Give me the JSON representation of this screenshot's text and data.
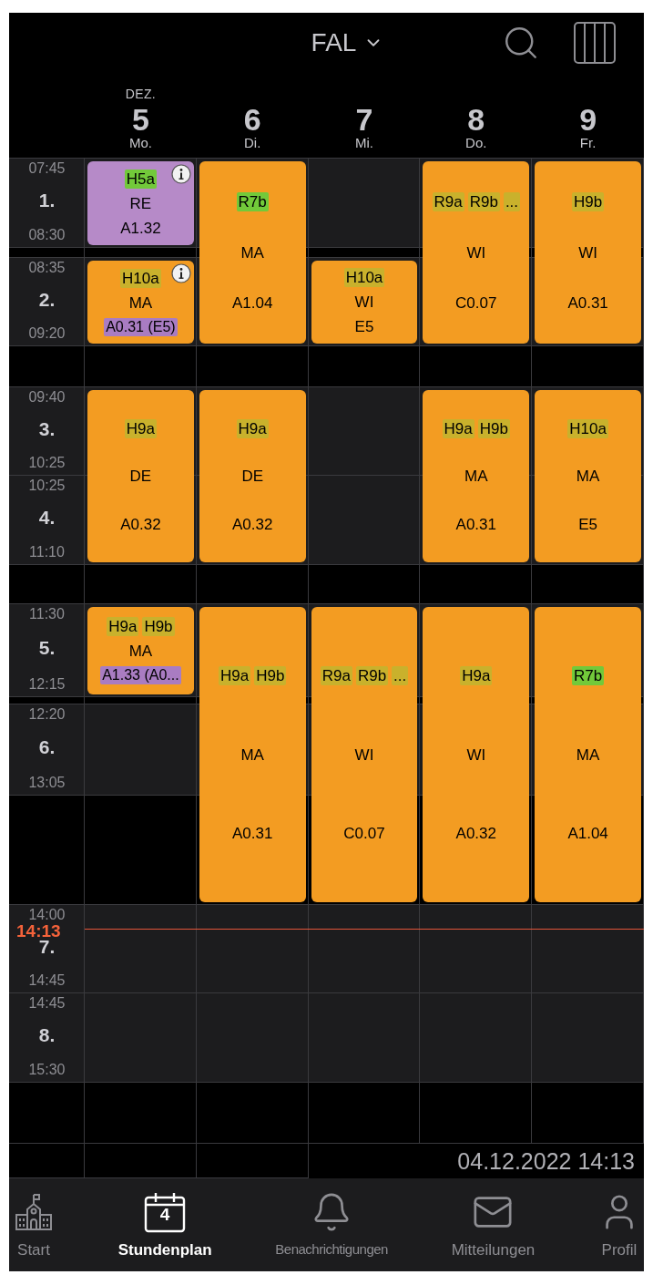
{
  "header": {
    "title": "FAL"
  },
  "month": "DEZ.",
  "days": [
    {
      "date": "5",
      "weekday": "Mo.",
      "lessons": [
        {
          "kind": "p1",
          "color": "#b68ac8",
          "info": true,
          "classes": [
            {
              "name": "H5a",
              "color": "#72c93a"
            }
          ],
          "subject": "RE",
          "room": "A1.32",
          "room_changed": false
        },
        {
          "kind": "p2",
          "color": "#f39c22",
          "info": true,
          "classes": [
            {
              "name": "H10a",
              "color": "#c9b12c"
            }
          ],
          "subject": "MA",
          "room": "A0.31 (E5)",
          "room_changed": true
        },
        {
          "kind": "p34",
          "color": "#f39c22",
          "info": false,
          "classes": [
            {
              "name": "H9a",
              "color": "#c9b12c"
            }
          ],
          "subject": "DE",
          "room": "A0.32",
          "room_changed": false
        },
        {
          "kind": "p5",
          "color": "#f39c22",
          "info": false,
          "classes": [
            {
              "name": "H9a",
              "color": "#c9b12c"
            },
            {
              "name": "H9b",
              "color": "#c9b12c"
            }
          ],
          "subject": "MA",
          "room": "A1.33 (A0...",
          "room_changed": true
        }
      ]
    },
    {
      "date": "6",
      "weekday": "Di.",
      "lessons": [
        {
          "kind": "p12",
          "color": "#f39c22",
          "info": false,
          "classes": [
            {
              "name": "R7b",
              "color": "#72c93a"
            }
          ],
          "subject": "MA",
          "room": "A1.04",
          "room_changed": false
        },
        {
          "kind": "p34",
          "color": "#f39c22",
          "info": false,
          "classes": [
            {
              "name": "H9a",
              "color": "#c9b12c"
            }
          ],
          "subject": "DE",
          "room": "A0.32",
          "room_changed": false
        },
        {
          "kind": "p56",
          "color": "#f39c22",
          "info": false,
          "classes": [
            {
              "name": "H9a",
              "color": "#c9b12c"
            },
            {
              "name": "H9b",
              "color": "#c9b12c"
            }
          ],
          "subject": "MA",
          "room": "A0.31",
          "room_changed": false
        }
      ]
    },
    {
      "date": "7",
      "weekday": "Mi.",
      "lessons": [
        {
          "kind": "p2",
          "color": "#f39c22",
          "info": false,
          "classes": [
            {
              "name": "H10a",
              "color": "#c9b12c"
            }
          ],
          "subject": "WI",
          "room": "E5",
          "room_changed": false
        },
        {
          "kind": "p56",
          "color": "#f39c22",
          "info": false,
          "classes": [
            {
              "name": "R9a",
              "color": "#c9b12c"
            },
            {
              "name": "R9b",
              "color": "#c9b12c"
            },
            {
              "name": "...",
              "color": "#c9b12c"
            }
          ],
          "subject": "WI",
          "room": "C0.07",
          "room_changed": false
        }
      ]
    },
    {
      "date": "8",
      "weekday": "Do.",
      "lessons": [
        {
          "kind": "p12",
          "color": "#f39c22",
          "info": false,
          "classes": [
            {
              "name": "R9a",
              "color": "#c9b12c"
            },
            {
              "name": "R9b",
              "color": "#c9b12c"
            },
            {
              "name": "...",
              "color": "#c9b12c"
            }
          ],
          "subject": "WI",
          "room": "C0.07",
          "room_changed": false
        },
        {
          "kind": "p34",
          "color": "#f39c22",
          "info": false,
          "classes": [
            {
              "name": "H9a",
              "color": "#c9b12c"
            },
            {
              "name": "H9b",
              "color": "#c9b12c"
            }
          ],
          "subject": "MA",
          "room": "A0.31",
          "room_changed": false
        },
        {
          "kind": "p56",
          "color": "#f39c22",
          "info": false,
          "classes": [
            {
              "name": "H9a",
              "color": "#c9b12c"
            }
          ],
          "subject": "WI",
          "room": "A0.32",
          "room_changed": false
        }
      ]
    },
    {
      "date": "9",
      "weekday": "Fr.",
      "lessons": [
        {
          "kind": "p12",
          "color": "#f39c22",
          "info": false,
          "classes": [
            {
              "name": "H9b",
              "color": "#c9b12c"
            }
          ],
          "subject": "WI",
          "room": "A0.31",
          "room_changed": false
        },
        {
          "kind": "p34",
          "color": "#f39c22",
          "info": false,
          "classes": [
            {
              "name": "H10a",
              "color": "#c9b12c"
            }
          ],
          "subject": "MA",
          "room": "E5",
          "room_changed": false
        },
        {
          "kind": "p56",
          "color": "#f39c22",
          "info": false,
          "classes": [
            {
              "name": "R7b",
              "color": "#72c93a"
            }
          ],
          "subject": "MA",
          "room": "A1.04",
          "room_changed": false
        }
      ]
    }
  ],
  "periods": [
    {
      "number": "1.",
      "start": "07:45",
      "end": "08:30"
    },
    {
      "number": "2.",
      "start": "08:35",
      "end": "09:20"
    },
    {
      "number": "3.",
      "start": "09:40",
      "end": "10:25"
    },
    {
      "number": "4.",
      "start": "10:25",
      "end": "11:10"
    },
    {
      "number": "5.",
      "start": "11:30",
      "end": "12:15"
    },
    {
      "number": "6.",
      "start": "12:20",
      "end": "13:05"
    },
    {
      "number": "7.",
      "start": "14:00",
      "end": "14:45"
    },
    {
      "number": "8.",
      "start": "14:45",
      "end": "15:30"
    }
  ],
  "now": {
    "time": "14:13"
  },
  "timestamp": "04.12.2022 14:13",
  "nav": [
    {
      "kind": "school",
      "label": "Start",
      "selected": false
    },
    {
      "kind": "calendar",
      "label": "Stundenplan",
      "selected": true,
      "calendar_day": "4"
    },
    {
      "kind": "bell",
      "label": "Benachrichtigungen",
      "selected": false
    },
    {
      "kind": "mail",
      "label": "Mitteilungen",
      "selected": false
    },
    {
      "kind": "user",
      "label": "Profil",
      "selected": false
    }
  ]
}
